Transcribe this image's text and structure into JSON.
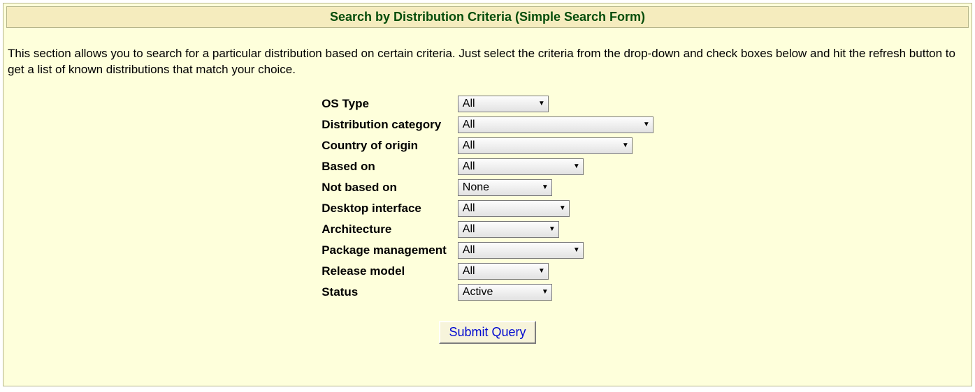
{
  "header": {
    "title": "Search by Distribution Criteria (Simple Search Form)"
  },
  "intro": "This section allows you to search for a particular distribution based on certain criteria. Just select the criteria from the drop-down and check boxes below and hit the refresh button to get a list of known distributions that match your choice.",
  "form": {
    "fields": [
      {
        "label": "OS Type",
        "value": "All",
        "widthClass": "w-os"
      },
      {
        "label": "Distribution category",
        "value": "All",
        "widthClass": "w-category"
      },
      {
        "label": "Country of origin",
        "value": "All",
        "widthClass": "w-origin"
      },
      {
        "label": "Based on",
        "value": "All",
        "widthClass": "w-based"
      },
      {
        "label": "Not based on",
        "value": "None",
        "widthClass": "w-notbased"
      },
      {
        "label": "Desktop interface",
        "value": "All",
        "widthClass": "w-desktop"
      },
      {
        "label": "Architecture",
        "value": "All",
        "widthClass": "w-arch"
      },
      {
        "label": "Package management",
        "value": "All",
        "widthClass": "w-pkg"
      },
      {
        "label": "Release model",
        "value": "All",
        "widthClass": "w-release"
      },
      {
        "label": "Status",
        "value": "Active",
        "widthClass": "w-status"
      }
    ],
    "submit_label": "Submit Query"
  }
}
